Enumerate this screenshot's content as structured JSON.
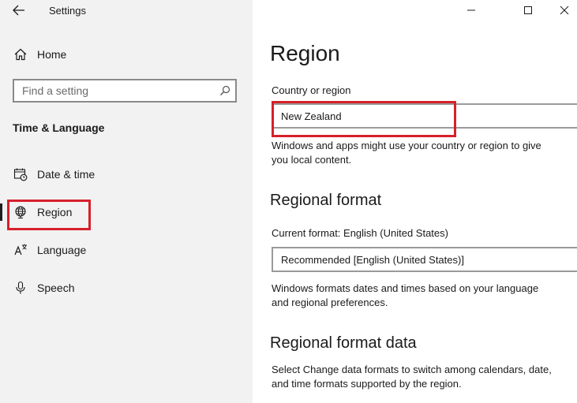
{
  "window": {
    "title": "Settings",
    "controls": [
      "minimize",
      "maximize",
      "close"
    ]
  },
  "sidebar": {
    "home_label": "Home",
    "search": {
      "placeholder": "Find a setting",
      "value": ""
    },
    "section_title": "Time & Language",
    "items": [
      {
        "label": "Date & time",
        "icon": "calendar-clock-icon",
        "active": false
      },
      {
        "label": "Region",
        "icon": "globe-icon",
        "active": true
      },
      {
        "label": "Language",
        "icon": "language-icon",
        "active": false
      },
      {
        "label": "Speech",
        "icon": "microphone-icon",
        "active": false
      }
    ]
  },
  "main": {
    "page_title": "Region",
    "country": {
      "label": "Country or region",
      "value": "New Zealand",
      "description": "Windows and apps might use your country or region to give you local content."
    },
    "regional_format": {
      "heading": "Regional format",
      "label": "Current format: English (United States)",
      "value": "Recommended [English (United States)]",
      "description": "Windows formats dates and times based on your language and regional preferences."
    },
    "regional_format_data": {
      "heading": "Regional format data",
      "description": "Select Change data formats to switch among calendars, date, and time formats supported by the region."
    }
  },
  "colors": {
    "highlight": "#d6202a",
    "sidebar_bg": "#f2f2f2",
    "main_bg": "#ffffff"
  }
}
